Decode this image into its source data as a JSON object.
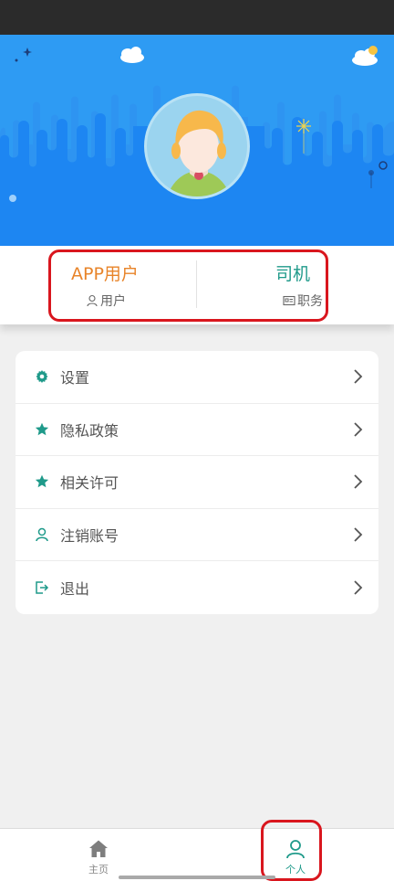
{
  "profile": {
    "username": "APP用户",
    "username_label": "用户",
    "role": "司机",
    "role_label": "职务"
  },
  "menu": {
    "items": [
      {
        "label": "设置",
        "icon": "gear-icon"
      },
      {
        "label": "隐私政策",
        "icon": "star-icon"
      },
      {
        "label": "相关许可",
        "icon": "star-icon"
      },
      {
        "label": "注销账号",
        "icon": "person-icon"
      },
      {
        "label": "退出",
        "icon": "exit-icon"
      }
    ]
  },
  "tabbar": {
    "home_label": "主页",
    "me_label": "个人"
  },
  "colors": {
    "header_blue": "#2e9bf3",
    "accent_orange": "#e8842a",
    "accent_teal": "#1f9a8a",
    "highlight_red": "#d9161e"
  }
}
